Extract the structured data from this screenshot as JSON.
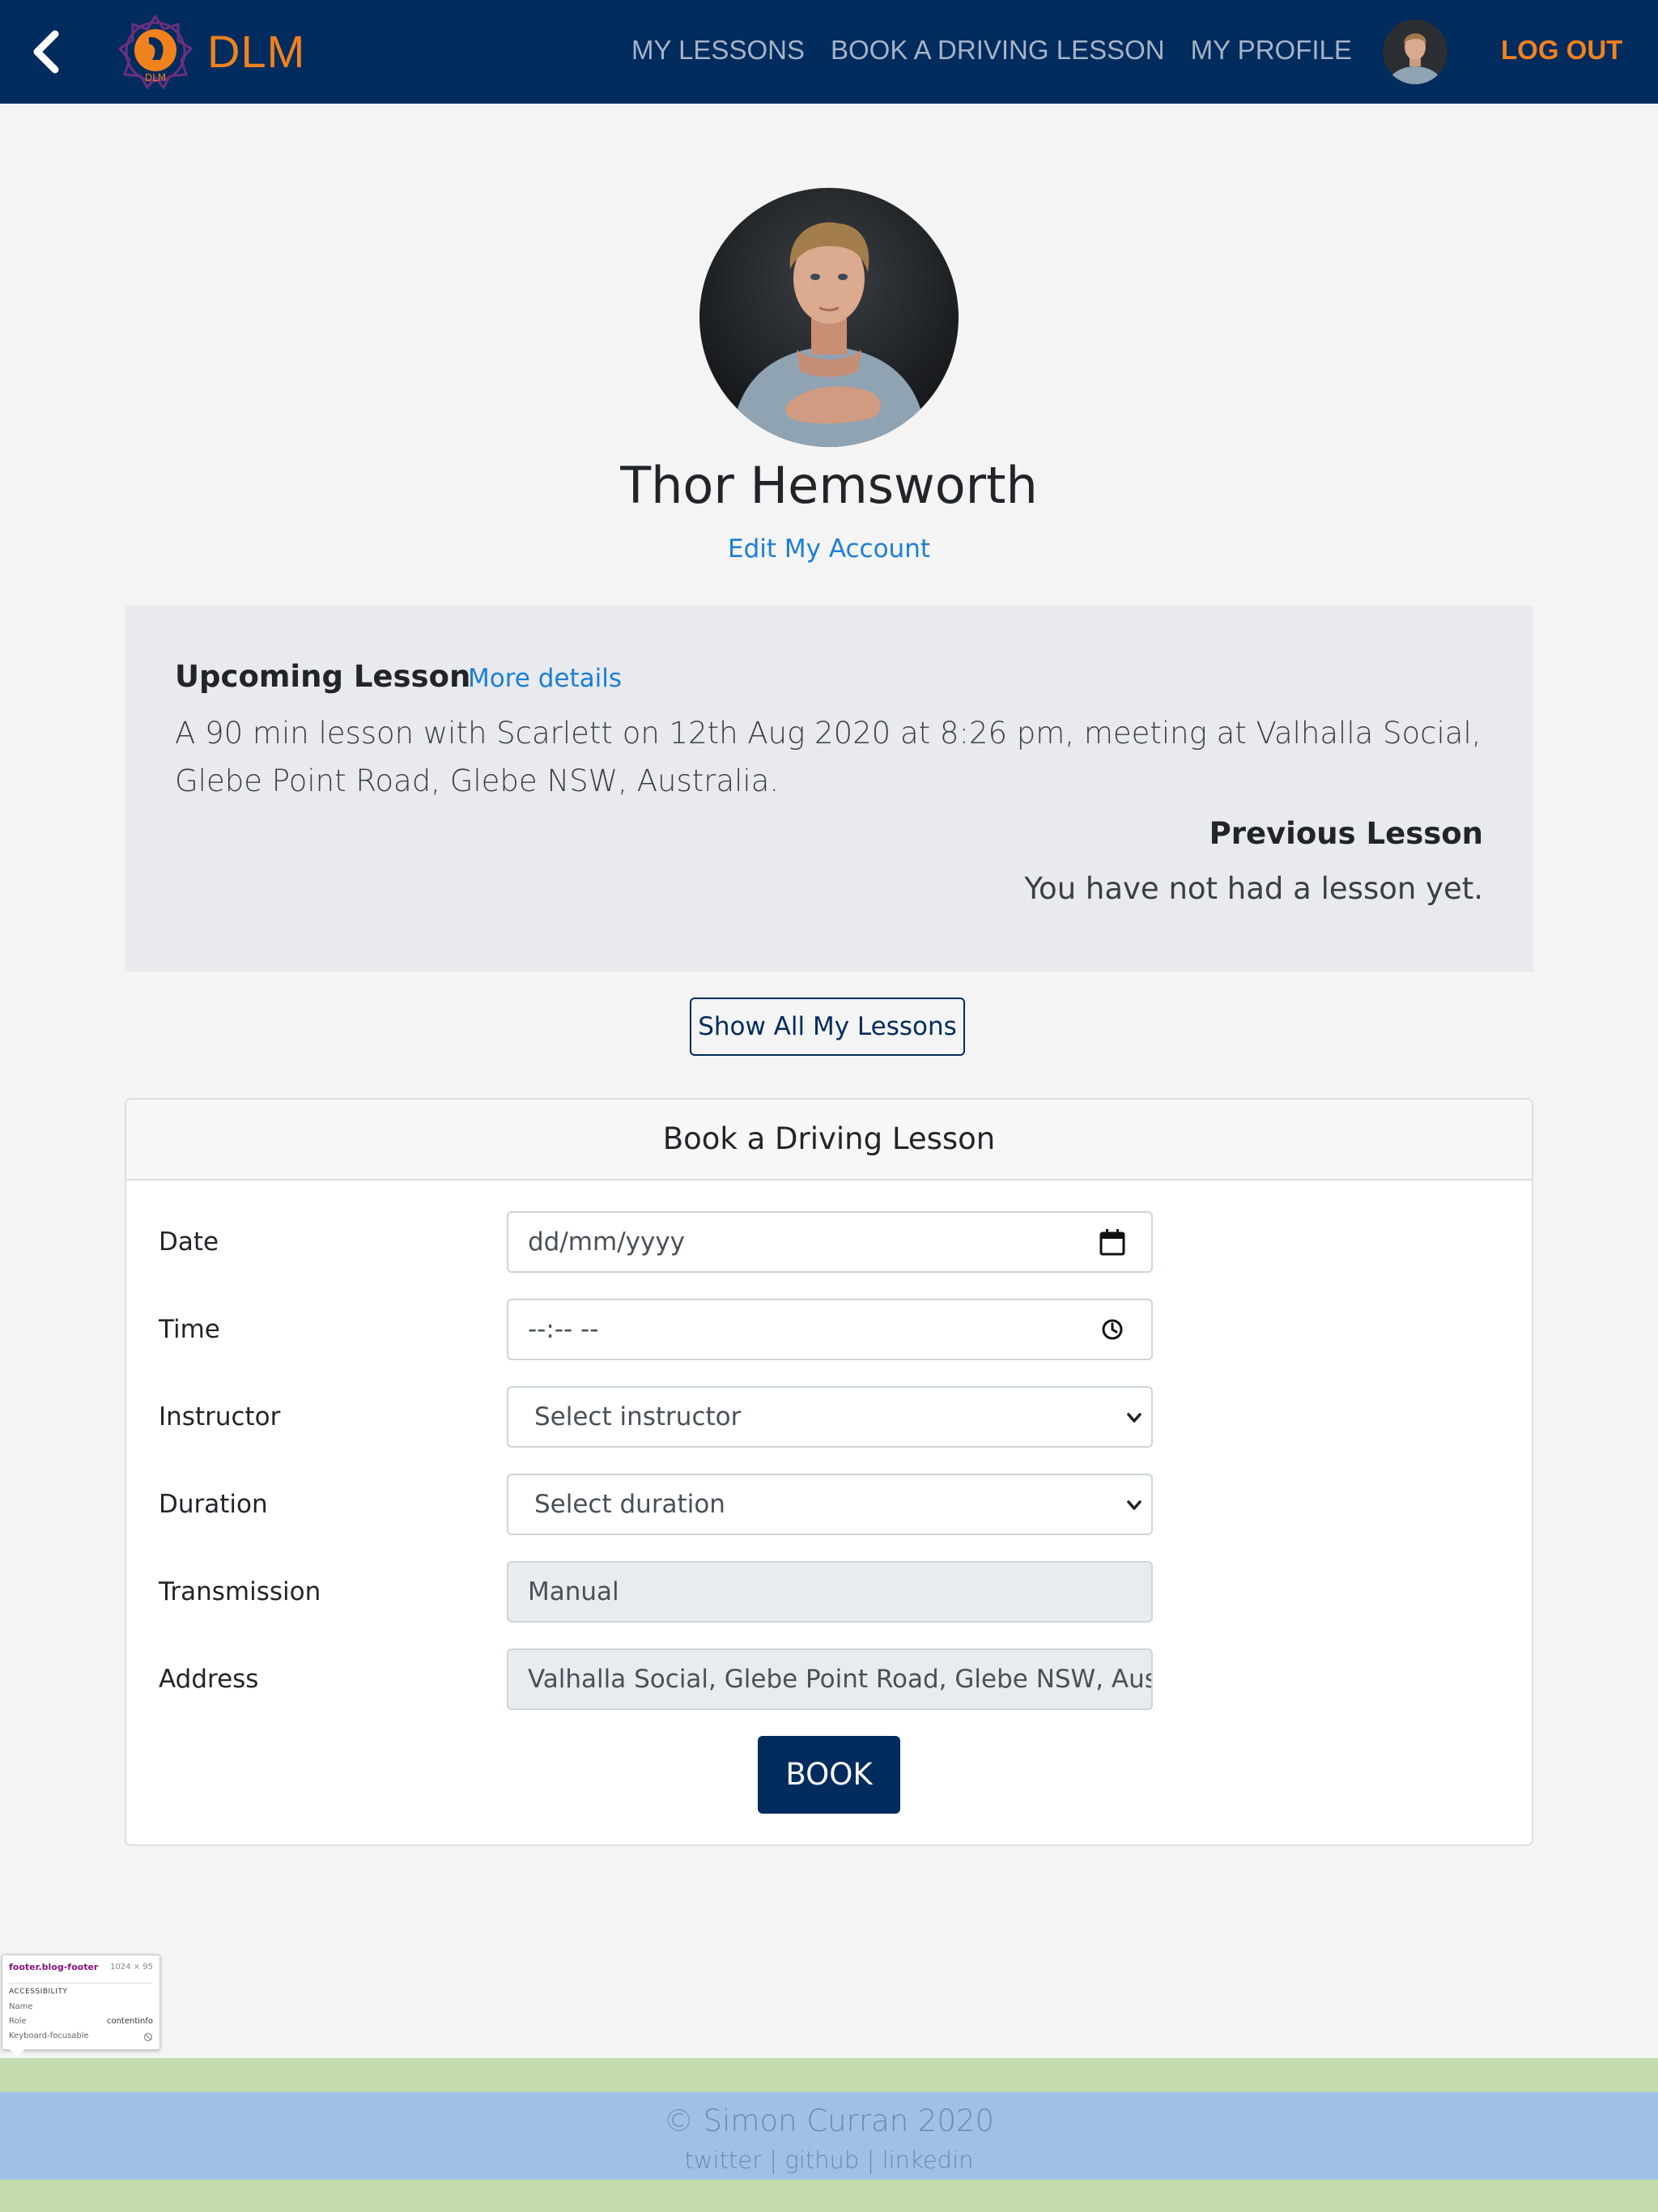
{
  "header": {
    "logo_text": "DLM",
    "logo_badge": "DLM",
    "nav": {
      "my_lessons": "MY LESSONS",
      "book_lesson": "BOOK A DRIVING LESSON",
      "my_profile": "MY PROFILE"
    },
    "logout": "LOG OUT",
    "colors": {
      "navbar": "#022b5e",
      "accent": "#f0821e"
    }
  },
  "profile": {
    "name": "Thor Hemsworth",
    "edit_link": "Edit My Account"
  },
  "lessons": {
    "upcoming_title": "Upcoming Lesson",
    "more_details": "More details",
    "upcoming_text": "A 90 min lesson with Scarlett on 12th Aug 2020 at 8:26 pm, meeting at Valhalla Social, Glebe Point Road, Glebe NSW, Australia.",
    "previous_title": "Previous Lesson",
    "previous_text": "You have not had a lesson yet.",
    "show_all": "Show All My Lessons"
  },
  "booking": {
    "title": "Book a Driving Lesson",
    "fields": {
      "date": {
        "label": "Date",
        "placeholder": "dd/mm/yyyy",
        "icon": "calendar-icon"
      },
      "time": {
        "label": "Time",
        "placeholder": "--:-- --",
        "icon": "clock-icon"
      },
      "instructor": {
        "label": "Instructor",
        "value": "Select instructor"
      },
      "duration": {
        "label": "Duration",
        "value": "Select duration"
      },
      "transmission": {
        "label": "Transmission",
        "value": "Manual"
      },
      "address": {
        "label": "Address",
        "value": "Valhalla Social, Glebe Point Road, Glebe NSW, Austral"
      }
    },
    "submit": "BOOK"
  },
  "devtools_tooltip": {
    "selector": "footer.blog-footer",
    "dimensions": "1024 × 95",
    "section": "ACCESSIBILITY",
    "name_key": "Name",
    "role_key": "Role",
    "role_value": "contentinfo",
    "focus_key": "Keyboard-focusable"
  },
  "footer": {
    "copyright": "© Simon Curran 2020",
    "links": [
      "twitter",
      "github",
      "linkedin"
    ],
    "separator": "|"
  }
}
